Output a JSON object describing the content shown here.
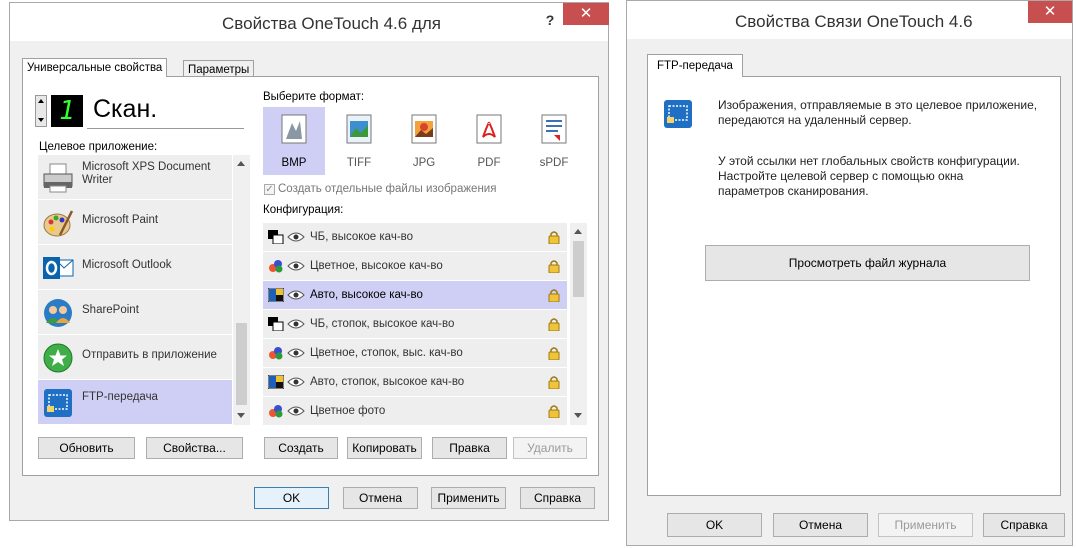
{
  "left_dialog": {
    "title": "Свойства OneTouch 4.6 для",
    "help": "?",
    "close": "✕",
    "tabs": [
      "Универсальные свойства",
      "Параметры"
    ],
    "button_counter": "1",
    "button_name": "Скан.",
    "destination_label": "Целевое приложение:",
    "destinations": [
      {
        "label": "Microsoft XPS Document Writer",
        "icon": "printer-icon"
      },
      {
        "label": "Microsoft Paint",
        "icon": "paint-palette-icon"
      },
      {
        "label": "Microsoft Outlook",
        "icon": "outlook-icon"
      },
      {
        "label": "SharePoint",
        "icon": "sharepoint-icon"
      },
      {
        "label": "Отправить в приложение",
        "icon": "send-to-app-icon"
      },
      {
        "label": "FTP-передача",
        "icon": "ftp-icon",
        "selected": true
      }
    ],
    "format_label": "Выберите формат:",
    "formats": [
      {
        "label": "BMP",
        "icon": "bmp-icon",
        "selected": true
      },
      {
        "label": "TIFF",
        "icon": "tiff-icon"
      },
      {
        "label": "JPG",
        "icon": "jpg-icon"
      },
      {
        "label": "PDF",
        "icon": "pdf-icon"
      },
      {
        "label": "sPDF",
        "icon": "spdf-icon"
      }
    ],
    "separate_files_label": "Создать отдельные файлы изображения",
    "separate_files_checked": true,
    "config_label": "Конфигурация:",
    "configs": [
      {
        "label": "ЧБ, высокое кач-во",
        "icon": "bw-icon"
      },
      {
        "label": "Цветное, высокое кач-во",
        "icon": "color-icon"
      },
      {
        "label": "Авто, высокое кач-во",
        "icon": "auto-icon",
        "selected": true
      },
      {
        "label": "ЧБ, стопок, высокое кач-во",
        "icon": "bw-icon"
      },
      {
        "label": "Цветное, стопок, выс. кач-во",
        "icon": "color-icon"
      },
      {
        "label": "Авто, стопок, высокое кач-во",
        "icon": "auto-icon"
      },
      {
        "label": "Цветное фото",
        "icon": "color-icon"
      }
    ],
    "buttons": {
      "refresh": "Обновить",
      "properties": "Свойства...",
      "create": "Создать",
      "copy": "Копировать",
      "edit": "Правка",
      "delete": "Удалить",
      "ok": "OK",
      "cancel": "Отмена",
      "apply": "Применить",
      "help": "Справка"
    }
  },
  "right_dialog": {
    "title": "Свойства Связи OneTouch 4.6",
    "close": "✕",
    "tab": "FTP-передача",
    "description": "Изображения, отправляемые в это целевое приложение, передаются на удаленный сервер.",
    "info": "У этой ссылки нет глобальных свойств конфигурации. Настройте целевой сервер с помощью окна параметров сканирования.",
    "view_log": "Просмотреть файл журнала",
    "buttons": {
      "ok": "OK",
      "cancel": "Отмена",
      "apply": "Применить",
      "help": "Справка"
    }
  },
  "colors": {
    "selection": "#cfcff5",
    "close_red": "#c74f4f",
    "counter_green": "#33ff33"
  }
}
